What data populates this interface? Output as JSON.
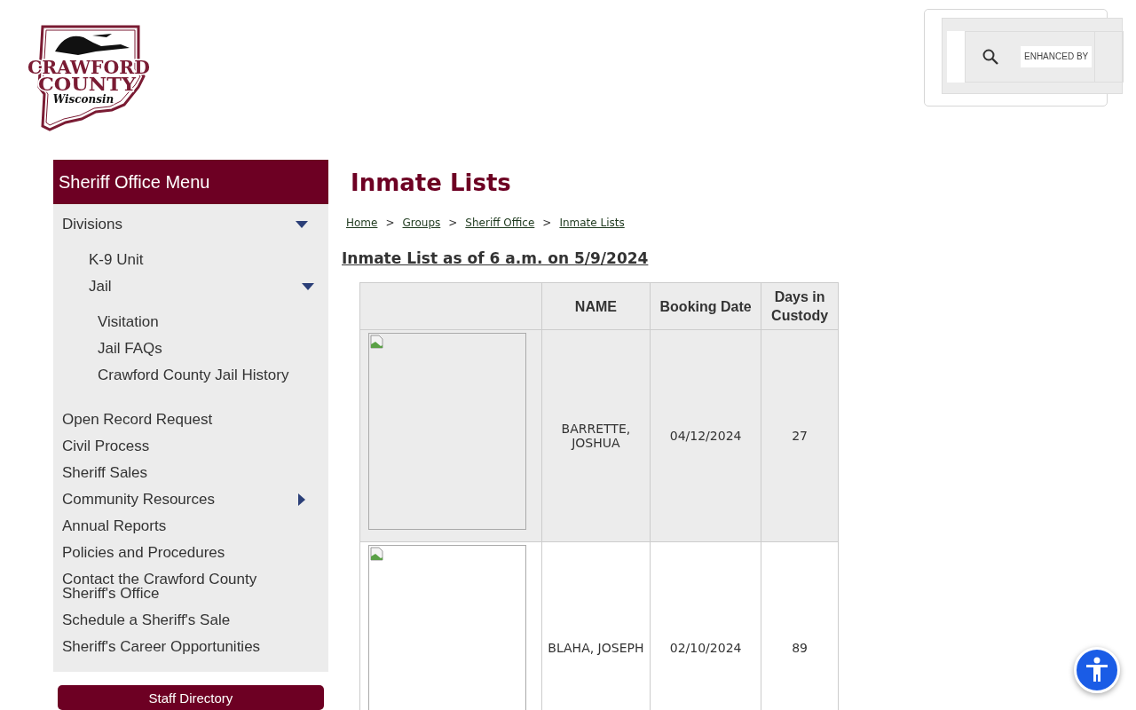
{
  "logo": {
    "lines": [
      "CRAWFORD",
      "COUNTY",
      "Wisconsin"
    ]
  },
  "search": {
    "badge": "ENHANCED BY"
  },
  "sidebar": {
    "title": "Sheriff Office Menu",
    "items": [
      {
        "label": "Divisions",
        "expanded": true,
        "children": [
          {
            "label": "K-9 Unit"
          },
          {
            "label": "Jail",
            "expanded": true,
            "children": [
              {
                "label": "Visitation"
              },
              {
                "label": "Jail FAQs"
              },
              {
                "label": "Crawford County Jail History"
              }
            ]
          }
        ]
      },
      {
        "label": "Open Record Request"
      },
      {
        "label": "Civil Process"
      },
      {
        "label": "Sheriff Sales"
      },
      {
        "label": "Community Resources",
        "expanded": false
      },
      {
        "label": "Annual Reports"
      },
      {
        "label": "Policies and Procedures"
      },
      {
        "label": "Contact the Crawford County Sheriff's Office"
      },
      {
        "label": "Schedule a Sheriff's Sale"
      },
      {
        "label": "Sheriff's Career Opportunities"
      }
    ],
    "button": "Staff Directory"
  },
  "page": {
    "title": "Inmate Lists",
    "breadcrumbs": [
      "Home",
      "Groups",
      "Sheriff Office",
      "Inmate Lists"
    ],
    "breadcrumb_separator": ">",
    "subheading": "Inmate List as of 6 a.m. on 5/9/2024"
  },
  "table": {
    "columns": [
      "NAME",
      "Booking Date",
      "Days in Custody"
    ],
    "rows": [
      {
        "name": "BARRETTE, JOSHUA",
        "booking_date": "04/12/2024",
        "days": "27"
      },
      {
        "name": "BLAHA, JOSEPH",
        "booking_date": "02/10/2024",
        "days": "89"
      }
    ]
  }
}
